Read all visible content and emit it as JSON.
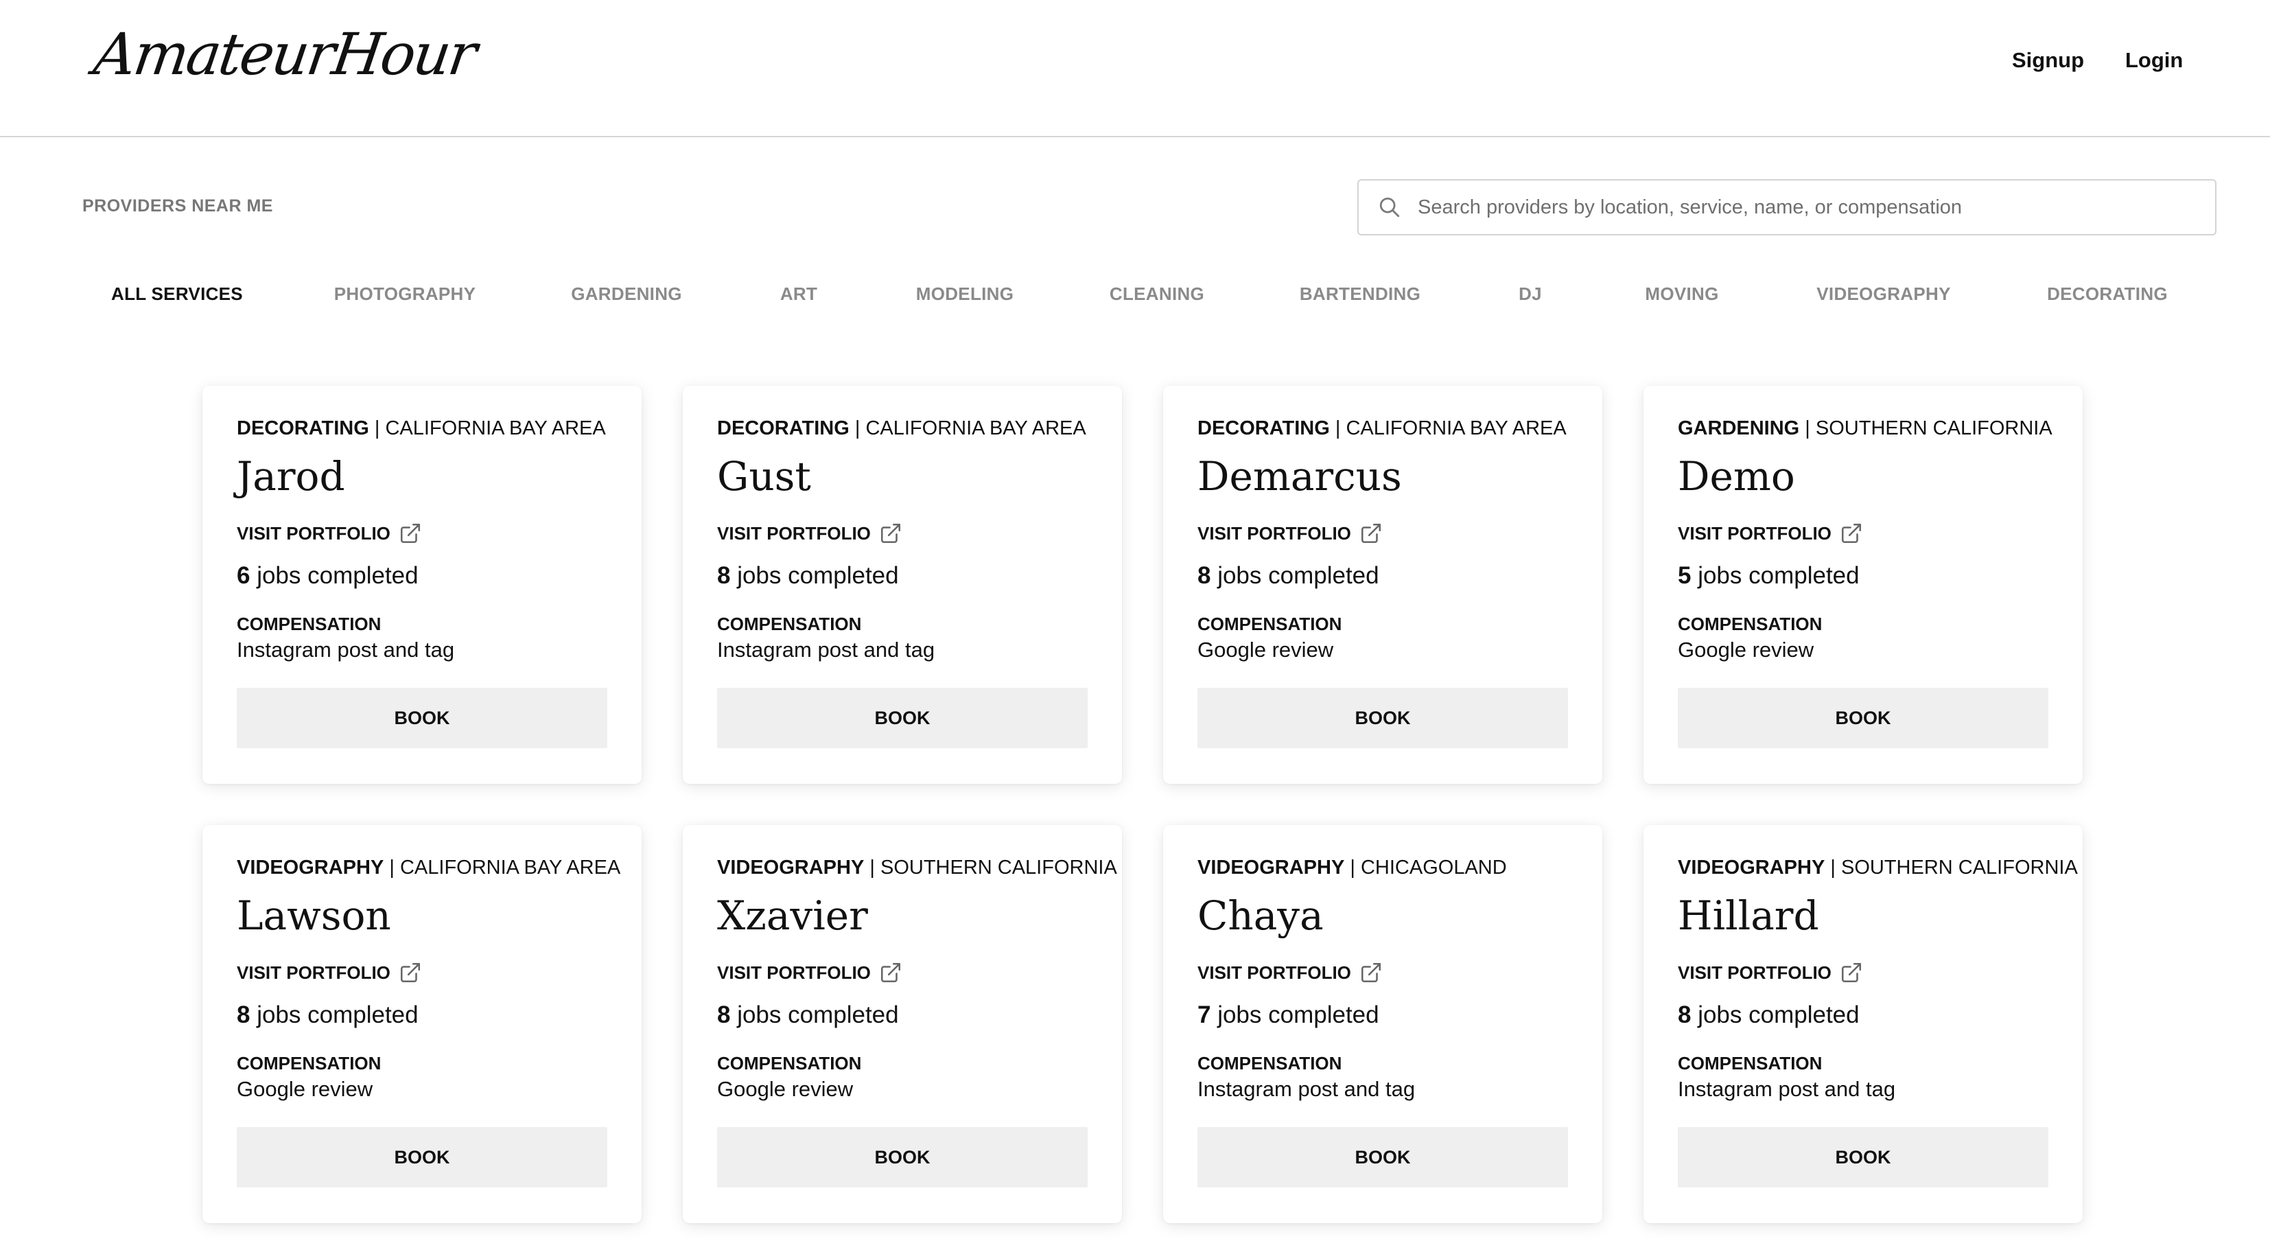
{
  "header": {
    "logo": "AmateurHour",
    "signup": "Signup",
    "login": "Login"
  },
  "toolbar": {
    "near_me": "PROVIDERS NEAR ME",
    "search_placeholder": "Search providers by location, service, name, or compensation"
  },
  "tabs": [
    {
      "label": "ALL SERVICES",
      "active": true
    },
    {
      "label": "PHOTOGRAPHY",
      "active": false
    },
    {
      "label": "GARDENING",
      "active": false
    },
    {
      "label": "ART",
      "active": false
    },
    {
      "label": "MODELING",
      "active": false
    },
    {
      "label": "CLEANING",
      "active": false
    },
    {
      "label": "BARTENDING",
      "active": false
    },
    {
      "label": "DJ",
      "active": false
    },
    {
      "label": "MOVING",
      "active": false
    },
    {
      "label": "VIDEOGRAPHY",
      "active": false
    },
    {
      "label": "DECORATING",
      "active": false
    }
  ],
  "card_labels": {
    "portfolio": "VISIT PORTFOLIO",
    "jobs_suffix": " jobs completed",
    "compensation": "COMPENSATION",
    "book": "BOOK"
  },
  "providers": [
    {
      "service": "DECORATING",
      "region": "CALIFORNIA BAY AREA",
      "name": "Jarod",
      "jobs": "6",
      "compensation": "Instagram post and tag"
    },
    {
      "service": "DECORATING",
      "region": "CALIFORNIA BAY AREA",
      "name": "Gust",
      "jobs": "8",
      "compensation": "Instagram post and tag"
    },
    {
      "service": "DECORATING",
      "region": "CALIFORNIA BAY AREA",
      "name": "Demarcus",
      "jobs": "8",
      "compensation": "Google review"
    },
    {
      "service": "GARDENING",
      "region": "SOUTHERN CALIFORNIA",
      "name": "Demo",
      "jobs": "5",
      "compensation": "Google review"
    },
    {
      "service": "VIDEOGRAPHY",
      "region": "CALIFORNIA BAY AREA",
      "name": "Lawson",
      "jobs": "8",
      "compensation": "Google review"
    },
    {
      "service": "VIDEOGRAPHY",
      "region": "SOUTHERN CALIFORNIA",
      "name": "Xzavier",
      "jobs": "8",
      "compensation": "Google review"
    },
    {
      "service": "VIDEOGRAPHY",
      "region": "CHICAGOLAND",
      "name": "Chaya",
      "jobs": "7",
      "compensation": "Instagram post and tag"
    },
    {
      "service": "VIDEOGRAPHY",
      "region": "SOUTHERN CALIFORNIA",
      "name": "Hillard",
      "jobs": "8",
      "compensation": "Instagram post and tag"
    }
  ]
}
